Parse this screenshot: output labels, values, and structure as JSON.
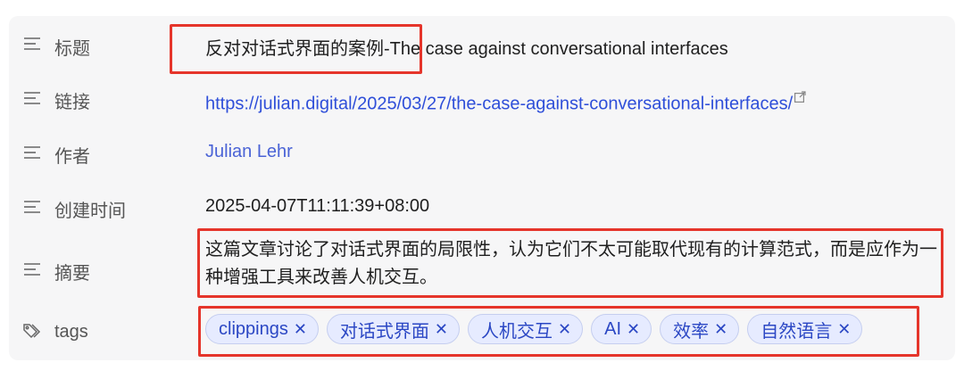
{
  "properties": {
    "title": {
      "label": "标题",
      "value": "反对对话式界面的案例-The case against conversational interfaces"
    },
    "link": {
      "label": "链接",
      "value": "https://julian.digital/2025/03/27/the-case-against-conversational-interfaces/"
    },
    "author": {
      "label": "作者",
      "value": "Julian Lehr"
    },
    "created": {
      "label": "创建时间",
      "value": "2025-04-07T11:11:39+08:00"
    },
    "summary": {
      "label": "摘要",
      "value": "这篇文章讨论了对话式界面的局限性，认为它们不太可能取代现有的计算范式，而是应作为一种增强工具来改善人机交互。"
    },
    "tags": {
      "label": "tags",
      "items": [
        "clippings",
        "对话式界面",
        "人机交互",
        "AI",
        "效率",
        "自然语言"
      ]
    }
  },
  "icons": {
    "property_icon": "list-lines-icon",
    "tags_icon": "tag-icon",
    "external_link_icon": "external-link-icon",
    "remove_tag_icon": "close-icon"
  },
  "colors": {
    "link": "#2f4fd9",
    "tag_bg": "#e6ebff",
    "tag_text": "#2b47c4",
    "highlight": "#e5352b"
  }
}
